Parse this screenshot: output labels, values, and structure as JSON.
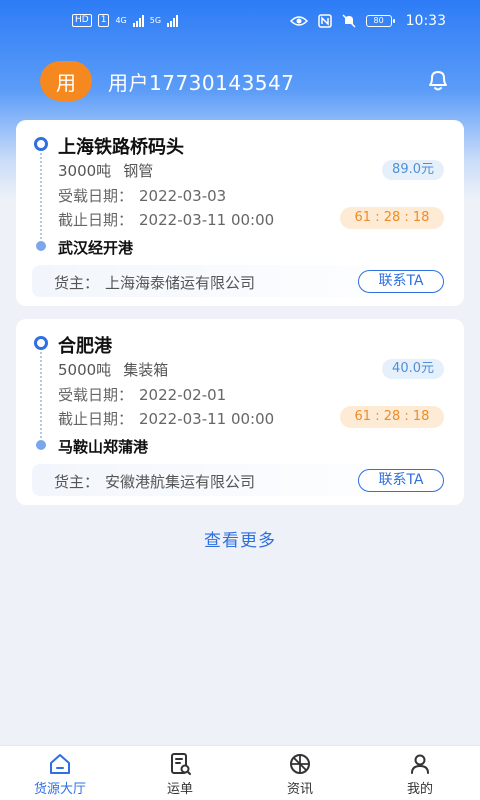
{
  "status_bar": {
    "left_chips": [
      "HD",
      "1"
    ],
    "network_1": "4G",
    "network_2": "5G",
    "battery": "80",
    "time": "10:33"
  },
  "header": {
    "avatar_text": "用",
    "username": "用户17730143547",
    "bell_icon": "bell-icon"
  },
  "cards": [
    {
      "origin": "上海铁路桥码头",
      "tonnage": "3000吨",
      "cargo_type": "钢管",
      "price": "89.0元",
      "load_date_label": "受载日期：",
      "load_date": "2022-03-03",
      "deadline_label": "截止日期：",
      "deadline": "2022-03-11 00:00",
      "countdown": "61 : 28 : 18",
      "destination": "武汉经开港",
      "owner_label": "货主：",
      "owner": "上海海泰储运有限公司",
      "contact_label": "联系TA"
    },
    {
      "origin": "合肥港",
      "tonnage": "5000吨",
      "cargo_type": "集装箱",
      "price": "40.0元",
      "load_date_label": "受载日期：",
      "load_date": "2022-02-01",
      "deadline_label": "截止日期：",
      "deadline": "2022-03-11 00:00",
      "countdown": "61 : 28 : 18",
      "destination": "马鞍山郑蒲港",
      "owner_label": "货主：",
      "owner": "安徽港航集运有限公司",
      "contact_label": "联系TA"
    }
  ],
  "view_more": "查看更多",
  "tabbar": [
    {
      "label": "货源大厅",
      "icon": "home-icon",
      "active": true
    },
    {
      "label": "运单",
      "icon": "waybill-icon",
      "active": false
    },
    {
      "label": "资讯",
      "icon": "news-icon",
      "active": false
    },
    {
      "label": "我的",
      "icon": "profile-icon",
      "active": false
    }
  ],
  "colors": {
    "primary": "#2f6fe0",
    "avatar": "#f5891f",
    "countdown_text": "#f18b25",
    "countdown_bg": "#fdebd6",
    "price_text": "#4f8fd8",
    "price_bg": "#e6f0fb"
  }
}
